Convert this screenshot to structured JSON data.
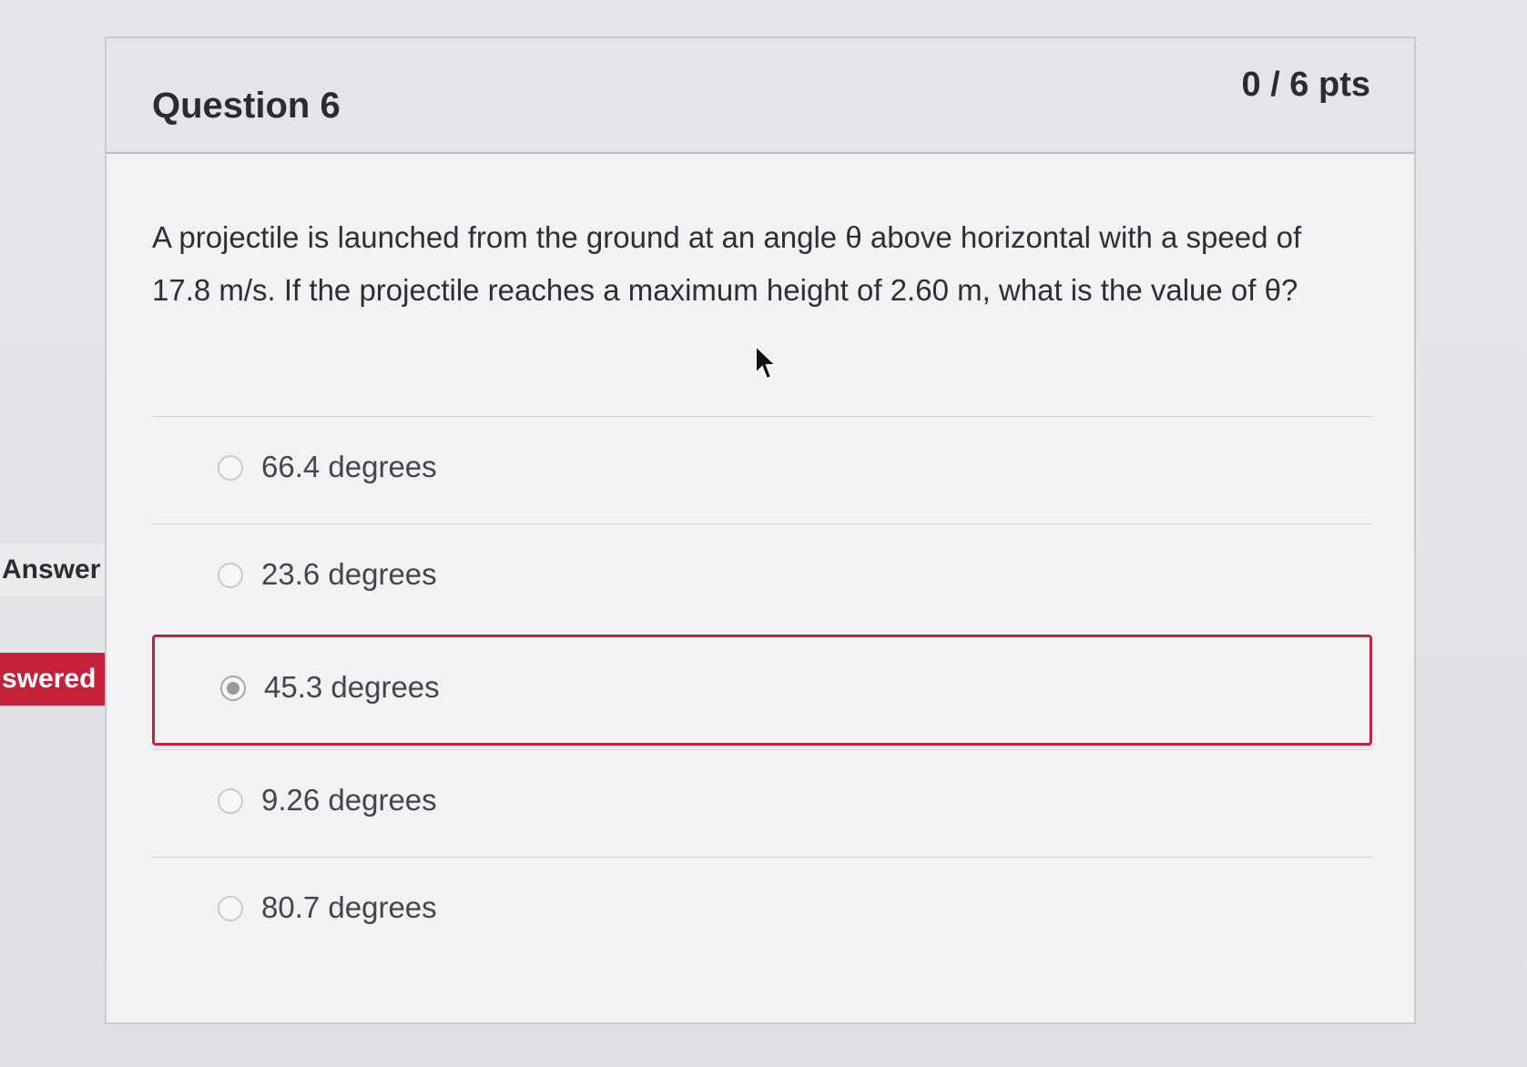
{
  "question": {
    "title": "Question 6",
    "points": "0 / 6 pts",
    "text": "A projectile is launched from the ground at an angle θ above horizontal with a speed of 17.8 m/s. If the projectile reaches a maximum height of 2.60 m, what is the value of θ?"
  },
  "tags": {
    "correct_label": "Answer",
    "selected_label": "swered"
  },
  "answers": [
    {
      "label": "66.4 degrees",
      "selected": false
    },
    {
      "label": "23.6 degrees",
      "selected": false
    },
    {
      "label": "45.3 degrees",
      "selected": true
    },
    {
      "label": "9.26 degrees",
      "selected": false
    },
    {
      "label": "80.7 degrees",
      "selected": false
    }
  ],
  "colors": {
    "selected_border": "#c8223a",
    "wrong_tag": "#c5213a",
    "correct_tag": "#ebebee"
  }
}
